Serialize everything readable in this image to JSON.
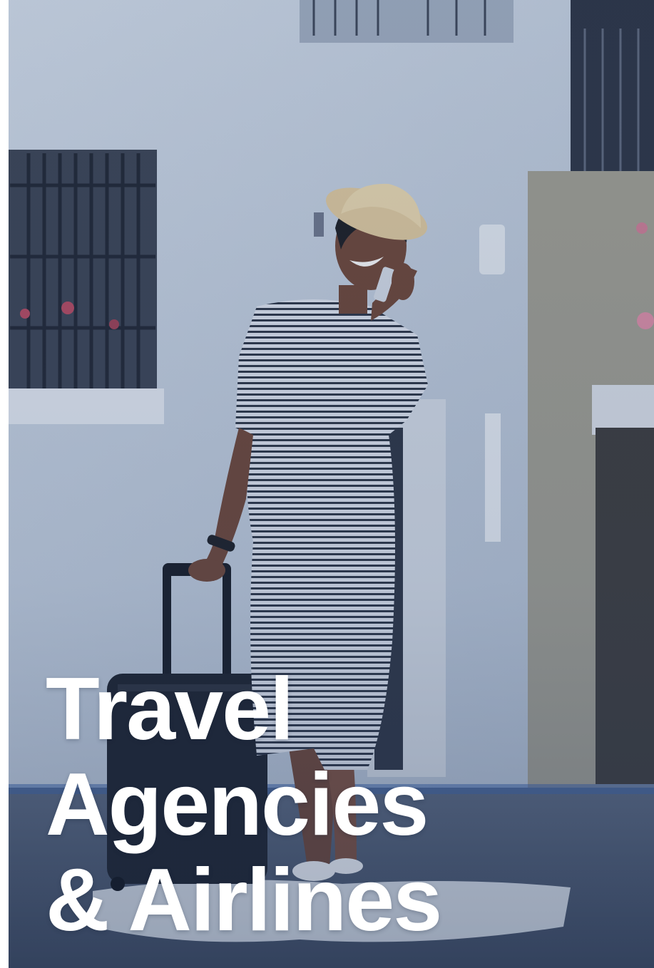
{
  "headline": {
    "lines": [
      "Travel",
      "Agencies",
      "& Airlines"
    ]
  },
  "photo": {
    "subject": "woman-with-suitcase-on-phone",
    "overlay_color": "#2f4a78"
  }
}
